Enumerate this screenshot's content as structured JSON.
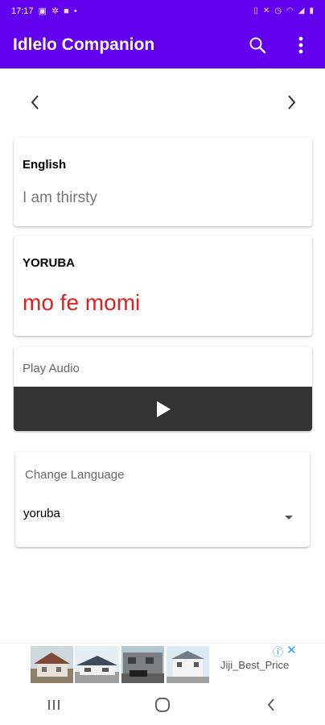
{
  "status_bar": {
    "time": "17:17",
    "left_icons": [
      "gallery-icon",
      "settings-icon",
      "photo-icon",
      "dot-icon"
    ],
    "right_icons": [
      "vibrate-icon",
      "mute-icon",
      "alarm-icon",
      "wifi-icon",
      "signal-icon",
      "battery-icon"
    ]
  },
  "app_bar": {
    "title": "Idlelo Companion",
    "search_icon": "search-icon",
    "menu_icon": "more-vert-icon",
    "color": "#6200ee"
  },
  "navigation": {
    "prev_icon": "chevron-left-icon",
    "next_icon": "chevron-right-icon"
  },
  "english_card": {
    "label": "English",
    "text": "I am thirsty"
  },
  "yoruba_card": {
    "label": "YORUBA",
    "text": "mo fe momi",
    "text_color": "#e0201e"
  },
  "audio_card": {
    "label": "Play Audio",
    "play_icon": "play-icon",
    "player_color": "#333333"
  },
  "language_card": {
    "title": "Change Language",
    "selected": "yoruba",
    "dropdown_icon": "arrow-drop-down-icon"
  },
  "ad_banner": {
    "advertiser": "Jiji_Best_Price",
    "info_icon": "info-icon",
    "close_icon": "close-icon"
  },
  "system_nav": {
    "recents_icon": "recents-icon",
    "home_icon": "home-icon",
    "back_icon": "back-icon"
  }
}
